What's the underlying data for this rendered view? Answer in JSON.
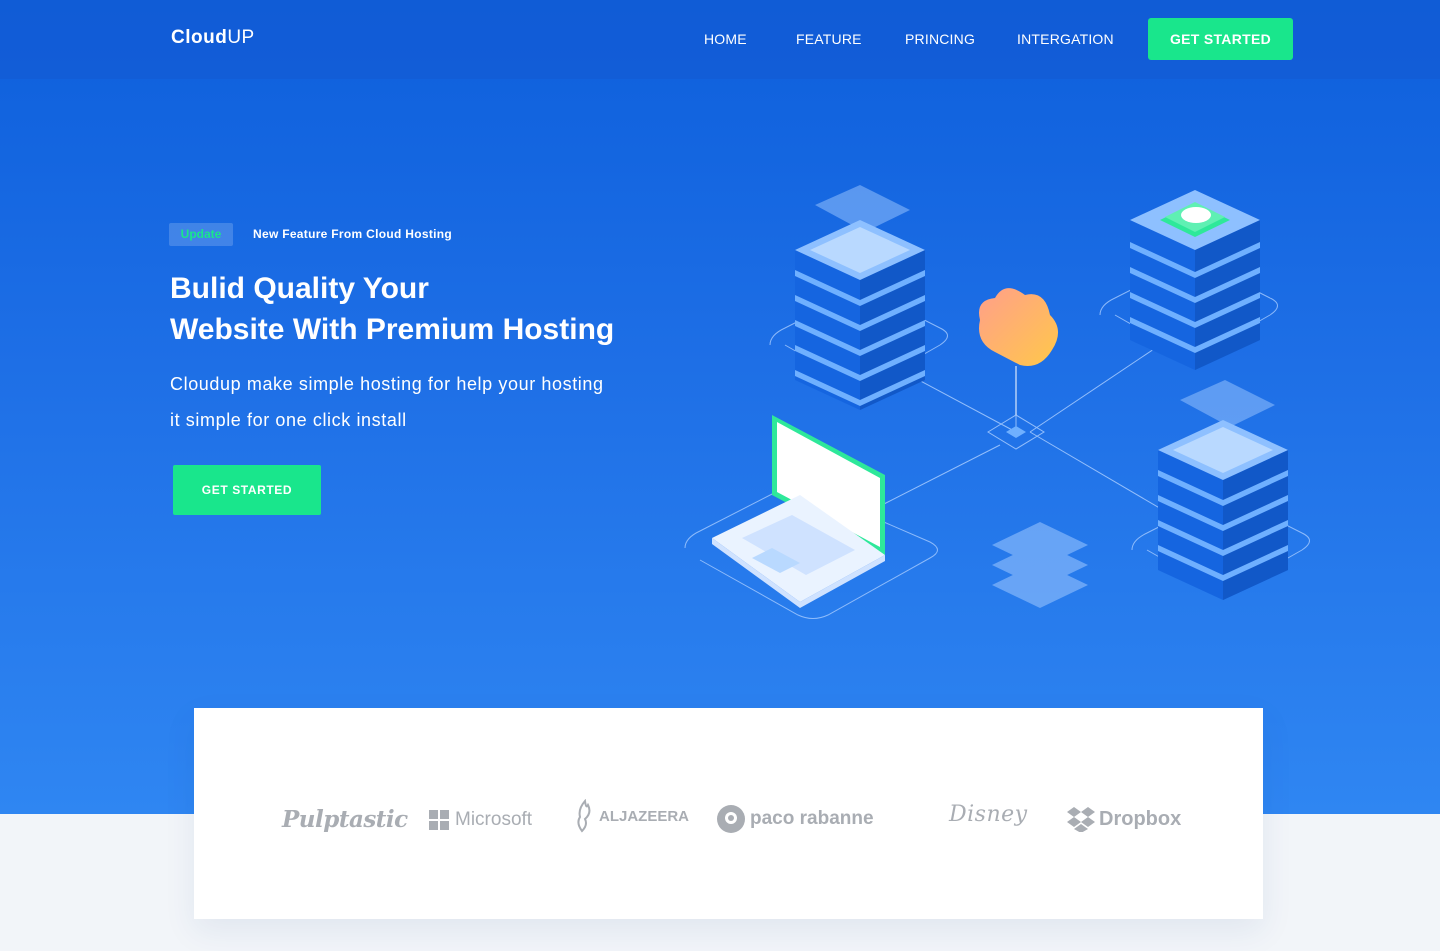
{
  "nav": {
    "brand_bold": "Cloud",
    "brand_light": "UP",
    "links": [
      "HOME",
      "FEATURE",
      "PRINCING",
      "INTERGATION"
    ],
    "cta": "GET STARTED"
  },
  "hero": {
    "badge": "Update",
    "badge_text": "New Feature From Cloud Hosting",
    "headline_line1": "Bulid Quality Your",
    "headline_line2": "Website With Premium Hosting",
    "subtext_line1": "Cloudup make simple hosting for help your hosting",
    "subtext_line2": "it simple for one click install",
    "cta": "GET STARTED"
  },
  "logos": {
    "items": [
      "Pulptastic",
      "Microsoft",
      "ALJAZEERA",
      "paco rabanne",
      "Disney",
      "Dropbox"
    ]
  },
  "colors": {
    "primary_blue": "#1e6fe6",
    "accent_green": "#19e68c",
    "logo_gray": "#a9adb3"
  }
}
